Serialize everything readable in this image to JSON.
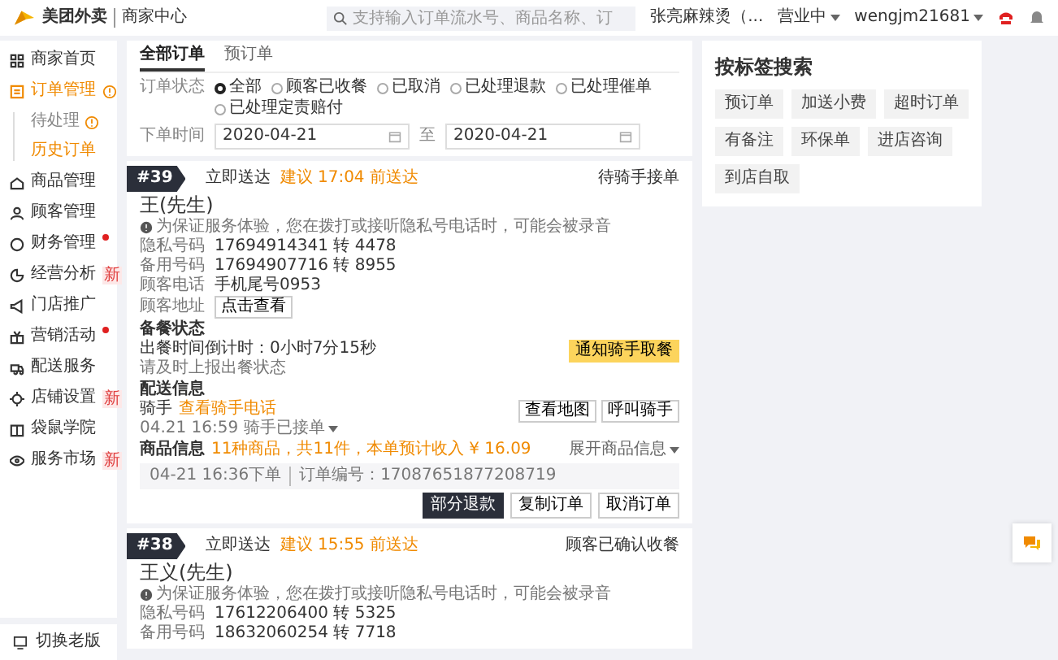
{
  "topbar": {
    "logo_text": "美团外卖",
    "logo_subtext": "商家中心",
    "search": {
      "placeholder": "支持输入订单流水号、商品名称、订"
    },
    "store": "张亮麻辣烫（...",
    "status": "营业中",
    "user": "wengjm21681"
  },
  "sidebar": {
    "items": [
      {
        "label": "商家首页",
        "selected": false
      },
      {
        "label": "订单管理",
        "selected": true,
        "badge": {
          "kind": "alert"
        },
        "children": [
          {
            "label": "待处理",
            "selected": false,
            "badge": {
              "kind": "alert"
            }
          },
          {
            "label": "历史订单",
            "selected": true
          }
        ]
      },
      {
        "label": "商品管理",
        "selected": false
      },
      {
        "label": "顾客管理",
        "selected": false
      },
      {
        "label": "财务管理",
        "selected": false,
        "badge": {
          "kind": "dot"
        }
      },
      {
        "label": "经营分析",
        "selected": false,
        "badge": {
          "kind": "new",
          "text": "新"
        }
      },
      {
        "label": "门店推广",
        "selected": false
      },
      {
        "label": "营销活动",
        "selected": false,
        "badge": {
          "kind": "dot"
        }
      },
      {
        "label": "配送服务",
        "selected": false
      },
      {
        "label": "店铺设置",
        "selected": false,
        "badge": {
          "kind": "new",
          "text": "新"
        }
      },
      {
        "label": "袋鼠学院",
        "selected": false
      },
      {
        "label": "服务市场",
        "selected": false,
        "badge": {
          "kind": "new",
          "text": "新"
        }
      }
    ],
    "footer": "切换老版"
  },
  "filter": {
    "tabs": [
      {
        "label": "全部订单",
        "selected": true
      },
      {
        "label": "预订单",
        "selected": false
      }
    ],
    "status_label": "订单状态",
    "statuses": [
      {
        "label": "全部",
        "selected": true
      },
      {
        "label": "顾客已收餐",
        "selected": false
      },
      {
        "label": "已取消",
        "selected": false
      },
      {
        "label": "已处理退款",
        "selected": false
      },
      {
        "label": "已处理催单",
        "selected": false
      },
      {
        "label": "已处理定责赔付",
        "selected": false
      }
    ],
    "date_label": "下单时间",
    "date_from": "2020-04-21",
    "date_sep": "至",
    "date_to": "2020-04-21"
  },
  "orders": [
    {
      "number": "#39",
      "delivery": "立即送达",
      "eta": "建议 17:04 前送达",
      "status": "待骑手接单",
      "customer": "王(先生)",
      "notice": "为保证服务体验，您在拨打或接听隐私号电话时，可能会被录音",
      "contacts": [
        {
          "kind": "text",
          "label": "隐私号码",
          "value": "17694914341 转 4478"
        },
        {
          "kind": "text",
          "label": "备用号码",
          "value": "17694907716 转 8955"
        },
        {
          "kind": "text",
          "label": "顾客电话",
          "value": "手机尾号0953"
        },
        {
          "kind": "button",
          "label": "顾客地址",
          "value": "点击查看"
        }
      ],
      "prep": {
        "title": "备餐状态",
        "countdown": "出餐时间倒计时：0小时7分15秒",
        "hint": "请及时上报出餐状态",
        "button": "通知骑手取餐"
      },
      "delivery_info": {
        "title": "配送信息",
        "rider_label": "骑手",
        "rider_link": "查看骑手电话",
        "rider_status": "04.21 16:59  骑手已接单",
        "buttons": [
          "查看地图",
          "呼叫骑手"
        ]
      },
      "goods": {
        "title": "商品信息",
        "summary": "11种商品，共11件，本单预计收入 ¥ 16.09",
        "expand": "展开商品信息"
      },
      "remark": {
        "placed": "04-21 16:36下单",
        "order_no": "订单编号：17087651877208719"
      },
      "actions": [
        {
          "label": "部分退款",
          "primary": true
        },
        {
          "label": "复制订单",
          "primary": false
        },
        {
          "label": "取消订单",
          "primary": false
        }
      ]
    },
    {
      "number": "#38",
      "delivery": "立即送达",
      "eta": "建议 15:55 前送达",
      "status": "顾客已确认收餐",
      "customer": "王义(先生)",
      "notice": "为保证服务体验，您在拨打或接听隐私号电话时，可能会被录音",
      "contacts": [
        {
          "kind": "text",
          "label": "隐私号码",
          "value": "17612206400 转 5325"
        },
        {
          "kind": "text",
          "label": "备用号码",
          "value": "18632060254 转 7718"
        }
      ]
    }
  ],
  "tag_search": {
    "title": "按标签搜索",
    "tags": [
      "预订单",
      "加送小费",
      "超时订单",
      "有备注",
      "环保单",
      "进店咨询",
      "到店自取"
    ]
  }
}
